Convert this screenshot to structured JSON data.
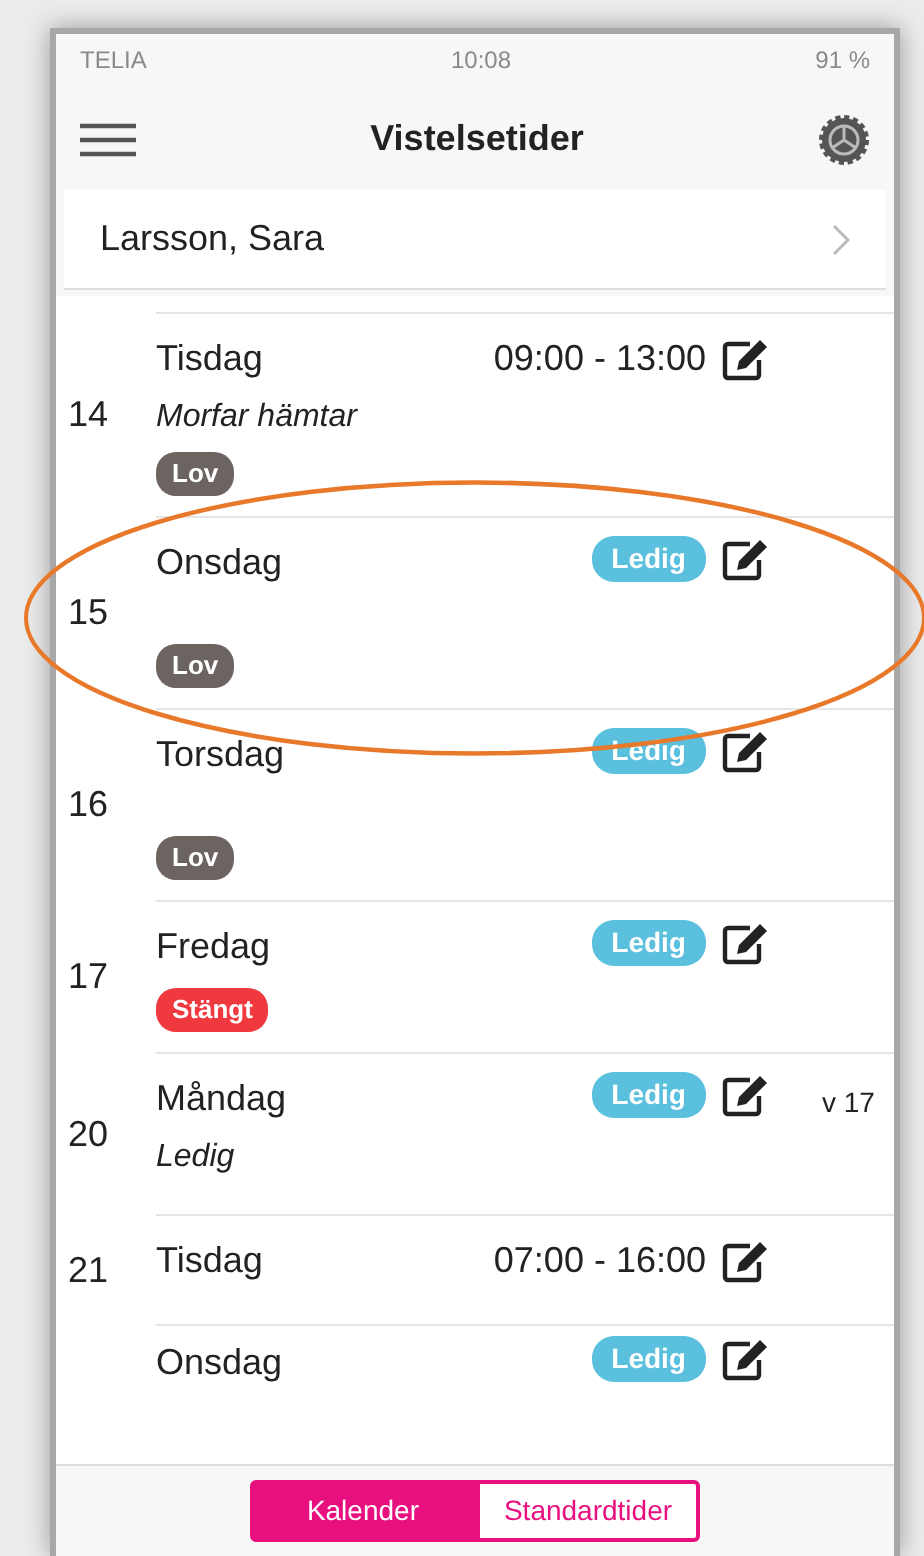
{
  "status_bar": {
    "carrier": "TELIA",
    "time": "10:08",
    "battery": "91 %"
  },
  "header": {
    "title": "Vistelsetider"
  },
  "child": {
    "name": "Larsson, Sara"
  },
  "days": [
    {
      "date": "14",
      "weekday": "Tisdag",
      "time": "09:00 - 13:00",
      "note": "Morfar hämtar",
      "tag": {
        "text": "Lov",
        "color": "#6b6461"
      },
      "highlighted": false
    },
    {
      "date": "15",
      "weekday": "Onsdag",
      "status": "Ledig",
      "tag": {
        "text": "Lov",
        "color": "#6b6461"
      },
      "highlighted": true
    },
    {
      "date": "16",
      "weekday": "Torsdag",
      "status": "Ledig",
      "tag": {
        "text": "Lov",
        "color": "#6b6461"
      },
      "highlighted": false
    },
    {
      "date": "17",
      "weekday": "Fredag",
      "status": "Ledig",
      "tag": {
        "text": "Stängt",
        "color": "#f0393f"
      },
      "highlighted": false
    },
    {
      "date": "20",
      "weekday": "Måndag",
      "status": "Ledig",
      "note": "Ledig",
      "week": "v 17",
      "highlighted": false
    },
    {
      "date": "21",
      "weekday": "Tisdag",
      "time": "07:00 - 16:00",
      "highlighted": false
    },
    {
      "weekday": "Onsdag",
      "status": "Ledig",
      "highlighted": false
    }
  ],
  "tabs": [
    {
      "label": "Kalender",
      "selected": true
    },
    {
      "label": "Standardtider",
      "selected": false
    }
  ]
}
